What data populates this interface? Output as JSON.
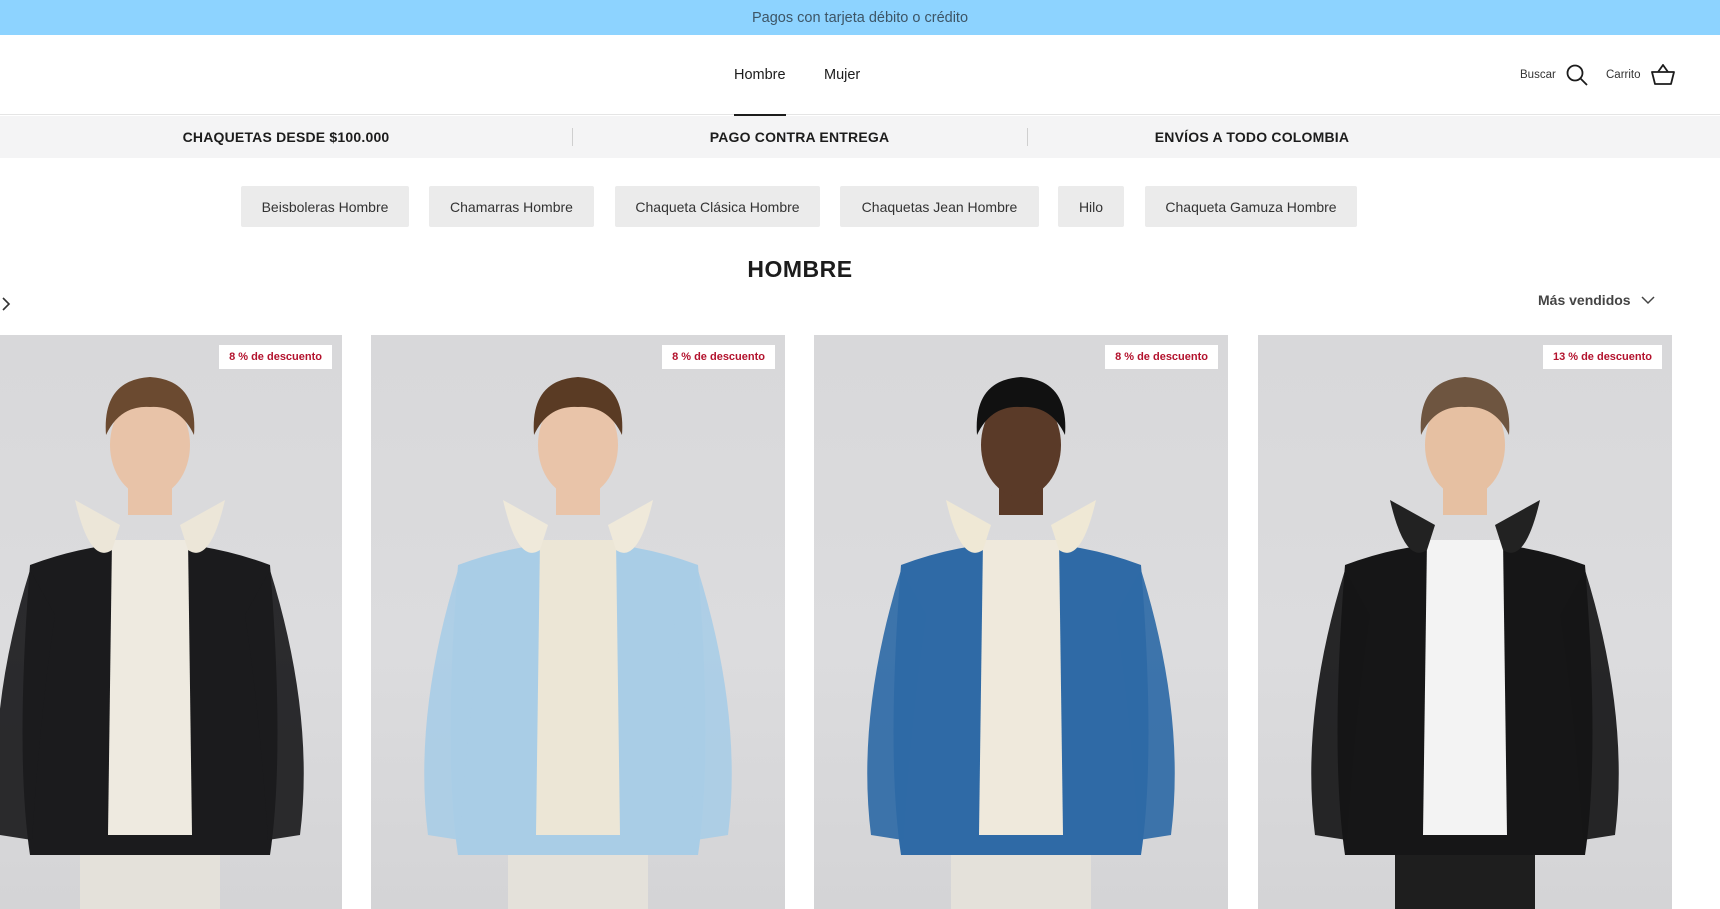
{
  "announcement": "Pagos con tarjeta débito o crédito",
  "nav": {
    "items": [
      "Hombre",
      "Mujer"
    ],
    "active": "Hombre"
  },
  "header": {
    "search_label": "Buscar",
    "cart_label": "Carrito"
  },
  "usp": [
    "CHAQUETAS DESDE $100.000",
    "PAGO CONTRA ENTREGA",
    "ENVÍOS A TODO COLOMBIA"
  ],
  "categories": [
    "Beisboleras Hombre",
    "Chamarras Hombre",
    "Chaqueta Clásica Hombre",
    "Chaquetas Jean Hombre",
    "Hilo",
    "Chaqueta Gamuza Hombre"
  ],
  "collection": {
    "title": "HOMBRE",
    "sort_label": "Más vendidos"
  },
  "products": [
    {
      "badge": "8 % de descuento",
      "jacket": "#1b1b1d",
      "collar": "#ece6d8",
      "shirt": "#eeeae0",
      "skin": "#e8c3a8",
      "hair": "#6b4a30"
    },
    {
      "badge": "8 % de descuento",
      "jacket": "#a9cde6",
      "collar": "#efe9da",
      "shirt": "#ece6d6",
      "skin": "#e9c4a9",
      "hair": "#5a3b24"
    },
    {
      "badge": "8 % de descuento",
      "jacket": "#2f6aa6",
      "collar": "#efe8d5",
      "shirt": "#efe9dc",
      "skin": "#5a3a28",
      "hair": "#111111"
    },
    {
      "badge": "13 % de descuento",
      "jacket": "#161617",
      "collar": "#222222",
      "shirt": "#f3f3f3",
      "skin": "#e6c0a2",
      "hair": "#6e5540"
    }
  ]
}
